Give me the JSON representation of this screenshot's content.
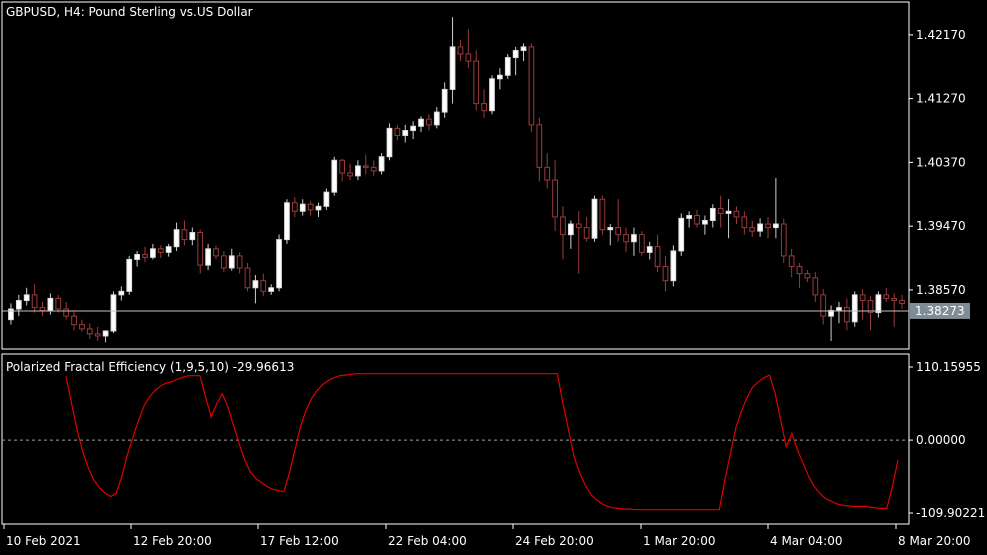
{
  "window_title": "GBPUSD, H4:  Pound Sterling vs.US Dollar",
  "colors": {
    "background": "#000000",
    "frame": "#ffffff",
    "bull_body": "#ffffff",
    "bear_body": "#000000",
    "bear_outline": "#9b3b3b",
    "wick": "#9b3b3b",
    "pfe_line": "#e00000",
    "bid_line": "#c0c0c0",
    "bid_badge": "#7f8c96",
    "zero_line": "#a0a0a0"
  },
  "chart_data": [
    {
      "type": "candlestick",
      "title": "GBPUSD, H4:  Pound Sterling vs.US Dollar",
      "ylim": [
        1.3775,
        1.4262
      ],
      "y_ticks": [
        "1.42170",
        "1.41270",
        "1.40370",
        "1.39470",
        "1.38570"
      ],
      "current_price": "1.38273",
      "candles": [
        [
          1.3815,
          1.3838,
          1.3808,
          1.383
        ],
        [
          1.383,
          1.385,
          1.382,
          1.3842
        ],
        [
          1.3842,
          1.386,
          1.3835,
          1.385
        ],
        [
          1.385,
          1.3865,
          1.3825,
          1.3832
        ],
        [
          1.3832,
          1.384,
          1.382,
          1.3828
        ],
        [
          1.3828,
          1.3852,
          1.3822,
          1.3845
        ],
        [
          1.3845,
          1.385,
          1.3825,
          1.383
        ],
        [
          1.383,
          1.384,
          1.3815,
          1.382
        ],
        [
          1.382,
          1.3828,
          1.38,
          1.3808
        ],
        [
          1.3808,
          1.3815,
          1.3798,
          1.3802
        ],
        [
          1.3802,
          1.381,
          1.3788,
          1.3795
        ],
        [
          1.3795,
          1.3805,
          1.3785,
          1.3792
        ],
        [
          1.3792,
          1.38,
          1.3783,
          1.3799
        ],
        [
          1.3799,
          1.3855,
          1.3796,
          1.385
        ],
        [
          1.385,
          1.3862,
          1.3842,
          1.3855
        ],
        [
          1.3855,
          1.3905,
          1.385,
          1.39
        ],
        [
          1.39,
          1.3912,
          1.389,
          1.3907
        ],
        [
          1.3907,
          1.3918,
          1.3896,
          1.3903
        ],
        [
          1.3903,
          1.3922,
          1.39,
          1.3915
        ],
        [
          1.3915,
          1.392,
          1.3902,
          1.391
        ],
        [
          1.391,
          1.3922,
          1.3904,
          1.3918
        ],
        [
          1.3918,
          1.3952,
          1.3912,
          1.3942
        ],
        [
          1.3942,
          1.3955,
          1.392,
          1.3928
        ],
        [
          1.3928,
          1.3945,
          1.392,
          1.3938
        ],
        [
          1.3938,
          1.3942,
          1.388,
          1.3892
        ],
        [
          1.3892,
          1.3922,
          1.3885,
          1.3915
        ],
        [
          1.3915,
          1.392,
          1.39,
          1.3905
        ],
        [
          1.3905,
          1.3912,
          1.3882,
          1.3888
        ],
        [
          1.3888,
          1.3915,
          1.3884,
          1.3905
        ],
        [
          1.3905,
          1.391,
          1.388,
          1.3888
        ],
        [
          1.3888,
          1.3895,
          1.3855,
          1.386
        ],
        [
          1.386,
          1.3878,
          1.3838,
          1.387
        ],
        [
          1.387,
          1.388,
          1.3848,
          1.3855
        ],
        [
          1.3855,
          1.3865,
          1.385,
          1.386
        ],
        [
          1.386,
          1.3935,
          1.3855,
          1.3928
        ],
        [
          1.3928,
          1.3985,
          1.3922,
          1.398
        ],
        [
          1.398,
          1.3988,
          1.396,
          1.3968
        ],
        [
          1.3968,
          1.3985,
          1.3962,
          1.3978
        ],
        [
          1.3978,
          1.3982,
          1.3962,
          1.397
        ],
        [
          1.397,
          1.398,
          1.396,
          1.3975
        ],
        [
          1.3975,
          1.4,
          1.397,
          1.3995
        ],
        [
          1.3995,
          1.4045,
          1.399,
          1.404
        ],
        [
          1.404,
          1.4042,
          1.401,
          1.4022
        ],
        [
          1.4022,
          1.4035,
          1.4012,
          1.4018
        ],
        [
          1.4018,
          1.404,
          1.4012,
          1.4032
        ],
        [
          1.4032,
          1.4048,
          1.402,
          1.403
        ],
        [
          1.403,
          1.404,
          1.4018,
          1.4025
        ],
        [
          1.4025,
          1.405,
          1.402,
          1.4045
        ],
        [
          1.4045,
          1.4092,
          1.404,
          1.4085
        ],
        [
          1.4085,
          1.409,
          1.4068,
          1.4075
        ],
        [
          1.4075,
          1.409,
          1.4065,
          1.4082
        ],
        [
          1.4082,
          1.4095,
          1.407,
          1.4088
        ],
        [
          1.4088,
          1.4102,
          1.408,
          1.4098
        ],
        [
          1.4098,
          1.4105,
          1.4082,
          1.409
        ],
        [
          1.409,
          1.4115,
          1.4085,
          1.4108
        ],
        [
          1.4108,
          1.415,
          1.41,
          1.414
        ],
        [
          1.414,
          1.4242,
          1.412,
          1.42
        ],
        [
          1.42,
          1.421,
          1.418,
          1.419
        ],
        [
          1.419,
          1.4225,
          1.417,
          1.418
        ],
        [
          1.418,
          1.4195,
          1.411,
          1.412
        ],
        [
          1.412,
          1.414,
          1.41,
          1.411
        ],
        [
          1.411,
          1.416,
          1.4105,
          1.4155
        ],
        [
          1.4155,
          1.417,
          1.414,
          1.416
        ],
        [
          1.416,
          1.419,
          1.4155,
          1.4185
        ],
        [
          1.4185,
          1.42,
          1.416,
          1.4195
        ],
        [
          1.4195,
          1.4205,
          1.418,
          1.42
        ],
        [
          1.42,
          1.4205,
          1.408,
          1.409
        ],
        [
          1.409,
          1.41,
          1.401,
          1.403
        ],
        [
          1.403,
          1.405,
          1.4,
          1.4012
        ],
        [
          1.4012,
          1.404,
          1.394,
          1.396
        ],
        [
          1.396,
          1.3975,
          1.39,
          1.3935
        ],
        [
          1.3935,
          1.3955,
          1.3915,
          1.395
        ],
        [
          1.395,
          1.3968,
          1.388,
          1.3945
        ],
        [
          1.3945,
          1.396,
          1.3925,
          1.393
        ],
        [
          1.393,
          1.399,
          1.3925,
          1.3985
        ],
        [
          1.3985,
          1.399,
          1.3935,
          1.3942
        ],
        [
          1.3942,
          1.395,
          1.392,
          1.3945
        ],
        [
          1.3945,
          1.3985,
          1.3925,
          1.3935
        ],
        [
          1.3935,
          1.3945,
          1.391,
          1.3925
        ],
        [
          1.3925,
          1.3945,
          1.3905,
          1.3935
        ],
        [
          1.3935,
          1.394,
          1.3905,
          1.391
        ],
        [
          1.391,
          1.3925,
          1.39,
          1.3918
        ],
        [
          1.3918,
          1.3935,
          1.3882,
          1.389
        ],
        [
          1.389,
          1.3905,
          1.3855,
          1.387
        ],
        [
          1.387,
          1.392,
          1.3862,
          1.3912
        ],
        [
          1.3912,
          1.3965,
          1.3905,
          1.3958
        ],
        [
          1.3958,
          1.3968,
          1.3945,
          1.3962
        ],
        [
          1.3962,
          1.397,
          1.3945,
          1.395
        ],
        [
          1.395,
          1.3962,
          1.3935,
          1.3955
        ],
        [
          1.3955,
          1.3978,
          1.3945,
          1.3972
        ],
        [
          1.3972,
          1.399,
          1.3945,
          1.3965
        ],
        [
          1.3965,
          1.3985,
          1.393,
          1.3968
        ],
        [
          1.3968,
          1.3975,
          1.395,
          1.396
        ],
        [
          1.396,
          1.3968,
          1.3935,
          1.3945
        ],
        [
          1.3945,
          1.3955,
          1.3932,
          1.394
        ],
        [
          1.394,
          1.3958,
          1.3932,
          1.395
        ],
        [
          1.395,
          1.396,
          1.393,
          1.3945
        ],
        [
          1.3945,
          1.4015,
          1.393,
          1.395
        ],
        [
          1.395,
          1.3958,
          1.3895,
          1.3905
        ],
        [
          1.3905,
          1.3915,
          1.3875,
          1.389
        ],
        [
          1.389,
          1.3895,
          1.386,
          1.388
        ],
        [
          1.388,
          1.3885,
          1.3868,
          1.3874
        ],
        [
          1.3874,
          1.3882,
          1.384,
          1.385
        ],
        [
          1.385,
          1.3858,
          1.3808,
          1.382
        ],
        [
          1.382,
          1.3835,
          1.3785,
          1.3828
        ],
        [
          1.3828,
          1.384,
          1.381,
          1.3832
        ],
        [
          1.3832,
          1.3845,
          1.38,
          1.3812
        ],
        [
          1.3812,
          1.3855,
          1.3805,
          1.385
        ],
        [
          1.385,
          1.3858,
          1.3815,
          1.3842
        ],
        [
          1.3842,
          1.3848,
          1.38,
          1.3825
        ],
        [
          1.3825,
          1.3855,
          1.3818,
          1.385
        ],
        [
          1.385,
          1.386,
          1.384,
          1.3845
        ],
        [
          1.3845,
          1.3852,
          1.3805,
          1.3842
        ],
        [
          1.3842,
          1.385,
          1.383,
          1.3838
        ]
      ]
    },
    {
      "type": "line",
      "title": "Polarized Fractal Efficiency (1,9,5,10) -29.96613",
      "ylim": [
        -109.90221,
        110.15955
      ],
      "y_ticks": [
        "110.15955",
        "0.00000",
        "-109.90221"
      ],
      "zero_line": 0,
      "series": [
        {
          "values": [
            96,
            55,
            15,
            -18,
            -42,
            -60,
            -72,
            -80,
            -85,
            -80,
            -55,
            -22,
            5,
            30,
            52,
            66,
            75,
            82,
            86,
            88,
            92,
            95,
            97,
            97,
            97,
            65,
            35,
            55,
            70,
            50,
            22,
            -5,
            -30,
            -48,
            -58,
            -64,
            -70,
            -74,
            -76,
            -78,
            -50,
            -15,
            20,
            45,
            63,
            75,
            84,
            90,
            94,
            97,
            98,
            99,
            100,
            100,
            100,
            100,
            100,
            100,
            100,
            100,
            100,
            100,
            100,
            100,
            100,
            100,
            100,
            100,
            100,
            100,
            100,
            100,
            100,
            100,
            100,
            100,
            100,
            100,
            100,
            100,
            100,
            100,
            100,
            100,
            100,
            100,
            100,
            100,
            100,
            55,
            15,
            -25,
            -50,
            -68,
            -82,
            -90,
            -96,
            -100,
            -102,
            -103,
            -104,
            -104,
            -105,
            -105,
            -105,
            -105,
            -105,
            -105,
            -105,
            -105,
            -105,
            -105,
            -105,
            -105,
            -105,
            -105,
            -105,
            -105,
            -60,
            -20,
            20,
            45,
            65,
            80,
            88,
            94,
            98,
            70,
            30,
            -10,
            10,
            -15,
            -35,
            -55,
            -70,
            -80,
            -88,
            -92,
            -96,
            -98,
            -99,
            -100,
            -100,
            -100,
            -101,
            -102,
            -103,
            -103,
            -70,
            -30
          ]
        }
      ]
    }
  ],
  "time_axis": [
    "10 Feb 2021",
    "12 Feb 20:00",
    "17 Feb 12:00",
    "22 Feb 04:00",
    "24 Feb 20:00",
    "1 Mar 20:00",
    "4 Mar 04:00",
    "8 Mar 20:00"
  ]
}
